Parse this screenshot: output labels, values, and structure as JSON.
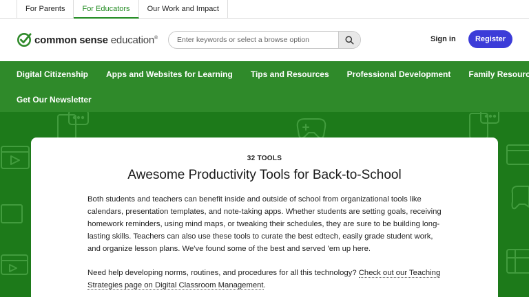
{
  "audience_tabs": [
    {
      "label": "For Parents"
    },
    {
      "label": "For Educators"
    },
    {
      "label": "Our Work and Impact"
    }
  ],
  "logo": {
    "bold": "common sense",
    "light": "education",
    "mark": "®",
    "check_color": "#2f8a2a"
  },
  "search": {
    "placeholder": "Enter keywords or select a browse option",
    "value": "",
    "icon": "search-icon"
  },
  "account": {
    "signin_label": "Sign in",
    "register_label": "Register"
  },
  "nav": {
    "row1": [
      "Digital Citizenship",
      "Apps and Websites for Learning",
      "Tips and Resources",
      "Professional Development",
      "Family Resources"
    ],
    "row2": [
      "Get Our Newsletter"
    ]
  },
  "collection": {
    "count": "32 TOOLS",
    "title": "Awesome Productivity Tools for Back-to-School",
    "description": "Both students and teachers can benefit inside and outside of school from organizational tools like calendars, presentation templates, and note-taking apps. Whether students are setting goals, receiving homework reminders, using mind maps, or tweaking their schedules, they are sure to be building long-lasting skills. Teachers can also use these tools to curate the best edtech, easily grade student work, and organize lesson plans. We've found some of the best and served 'em up here.",
    "help_text": "Need help developing norms, routines, and procedures for all this technology? ",
    "help_link": "Check out our Teaching Strategies page on Digital Classroom Management",
    "help_end": "."
  },
  "colors": {
    "nav_green": "#2f8a2a",
    "hero_green": "#1d7a1a",
    "register_blue": "#3c3cd8",
    "active_tab": "#1f8a1f"
  }
}
